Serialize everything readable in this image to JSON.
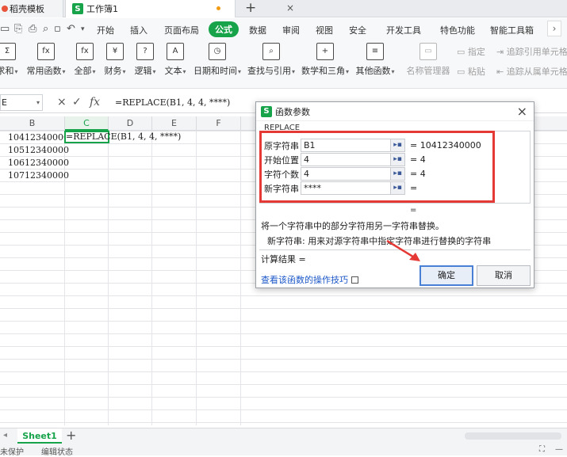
{
  "titlebar": {
    "home_tab": "稻壳模板",
    "doc_tab": "工作簿1",
    "close_glyph": "×",
    "add_glyph": "+"
  },
  "menubar": {
    "items": [
      "开始",
      "插入",
      "页面布局",
      "公式",
      "数据",
      "审阅",
      "视图",
      "安全",
      "开发工具",
      "特色功能",
      "智能工具箱"
    ],
    "active": "公式"
  },
  "ribbon": {
    "buttons": [
      {
        "label": "求和",
        "icon": "sum-icon",
        "glyph": "Σ"
      },
      {
        "label": "常用函数",
        "icon": "function-icon",
        "glyph": "fx"
      },
      {
        "label": "全部",
        "icon": "function-all-icon",
        "glyph": "fx"
      },
      {
        "label": "财务",
        "icon": "finance-icon",
        "glyph": "¥"
      },
      {
        "label": "逻辑",
        "icon": "logic-icon",
        "glyph": "?"
      },
      {
        "label": "文本",
        "icon": "text-icon",
        "glyph": "A"
      },
      {
        "label": "日期和时间",
        "icon": "clock-icon",
        "glyph": "◷"
      },
      {
        "label": "查找与引用",
        "icon": "lookup-icon",
        "glyph": "⌕"
      },
      {
        "label": "数学和三角",
        "icon": "math-icon",
        "glyph": "+"
      },
      {
        "label": "其他函数",
        "icon": "more-functions-icon",
        "glyph": "≡"
      },
      {
        "label": "名称管理器",
        "icon": "name-manager-icon",
        "glyph": "▭"
      }
    ],
    "small": {
      "assign": "指定",
      "paste": "粘贴",
      "trace_precedents": "追踪引用单元格",
      "trace_dependents": "追踪从属单元格"
    }
  },
  "formula_bar": {
    "name_box": "E",
    "cancel_glyph": "×",
    "confirm_glyph": "✓",
    "fx_glyph": "fx",
    "formula": "=REPLACE(B1, 4, 4, ****)"
  },
  "grid": {
    "columns": [
      "B",
      "C",
      "D",
      "E",
      "F"
    ],
    "b_values": [
      "10412340000",
      "10512340000",
      "10612340000",
      "10712340000"
    ],
    "active_cell_text": "=REPLACE(B1, 4, 4, ****)"
  },
  "dialog": {
    "title": "函数参数",
    "close_glyph": "×",
    "function_name": "REPLACE",
    "args": [
      {
        "label": "原字符串",
        "value": "B1",
        "result": "= 10412340000"
      },
      {
        "label": "开始位置",
        "value": "4",
        "result": "= 4"
      },
      {
        "label": "字符个数",
        "value": "4",
        "result": "= 4"
      },
      {
        "label": "新字符串",
        "value": "****",
        "result": "="
      }
    ],
    "overall_eq": "=",
    "description": "将一个字符串中的部分字符用另一字符串替换。",
    "param_help": "新字符串:  用来对源字符串中指定字符串进行替换的字符串",
    "result_label": "计算结果 =",
    "help_link": "查看该函数的操作技巧",
    "ok": "确定",
    "cancel": "取消"
  },
  "sheetbar": {
    "sheet": "Sheet1",
    "add_glyph": "+"
  },
  "statusbar": {
    "protect": "未保护",
    "edit": "编辑状态"
  },
  "colors": {
    "accent_green": "#16a34a",
    "highlight_red": "#e53935"
  }
}
